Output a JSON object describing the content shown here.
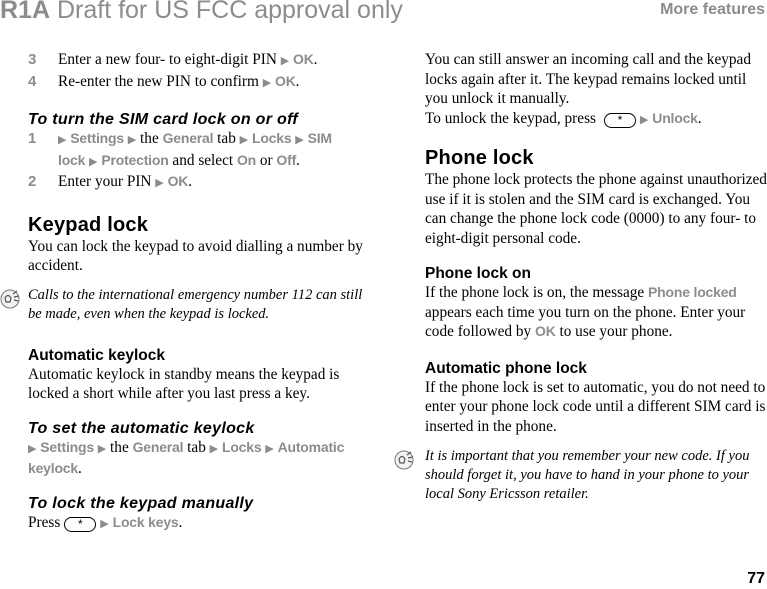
{
  "header": {
    "draft_bold": "R1A",
    "draft_rest": " Draft for US FCC approval only",
    "section_title": "More features"
  },
  "page_number": "77",
  "colors": {
    "ui_gray": "#8c8c8c",
    "text": "#000000"
  },
  "left": {
    "steps_top": [
      {
        "num": "3",
        "text": "Enter a new four- to eight-digit PIN ",
        "ui": "OK"
      },
      {
        "num": "4",
        "text": "Re-enter the new PIN to confirm ",
        "ui": "OK"
      }
    ],
    "sim_heading": "To turn the SIM card lock on or off",
    "sim_step1": {
      "num": "1",
      "settings": "Settings",
      "the": " the ",
      "general": "General",
      "tab": " tab ",
      "locks": "Locks",
      "sim_lock": "SIM lock",
      "protection": "Protection",
      "and_select": " and select ",
      "on": "On",
      "or": " or ",
      "off": "Off"
    },
    "sim_step2": {
      "num": "2",
      "text": "Enter your PIN ",
      "ui": "OK"
    },
    "keypad_heading": "Keypad lock",
    "keypad_body": "You can lock the keypad to avoid dialling a number by accident.",
    "keypad_note": "Calls to the international emergency number 112 can still be made, even when the keypad is locked.",
    "auto_heading": "Automatic keylock",
    "auto_body": "Automatic keylock in standby means the keypad is locked a short while after you last press a key.",
    "set_auto_heading": "To set the automatic keylock",
    "set_auto": {
      "settings": "Settings",
      "the": " the ",
      "general": "General",
      "tab": " tab ",
      "locks": "Locks",
      "automatic": "Automatic keylock"
    },
    "manual_heading": "To lock the keypad manually",
    "manual": {
      "press": "Press",
      "key": "*",
      "action": "Lock keys"
    }
  },
  "right": {
    "intro_body": "You can still answer an incoming call and the keypad locks again after it. The keypad remains locked until you unlock it manually.",
    "unlock": {
      "text": "To unlock the keypad, press",
      "key": "*",
      "action": "Unlock"
    },
    "phone_lock_heading": "Phone lock",
    "phone_lock_body": "The phone lock protects the phone against unauthorized use if it is stolen and the SIM card is exchanged. You can change the phone lock code (0000) to any four- to eight-digit personal code.",
    "phone_lock_on_heading": "Phone lock on",
    "phone_lock_on": {
      "pre": "If the phone lock is on, the message ",
      "ui": "Phone locked",
      "mid": " appears each time you turn on the phone. Enter your code followed by ",
      "ok": "OK",
      "post": " to use your phone."
    },
    "auto_phone_heading": "Automatic phone lock",
    "auto_phone_body": "If the phone lock is set to automatic, you do not need to enter your phone lock code until a different SIM card is inserted in the phone.",
    "note": "It is important that you remember your new code. If you should forget it, you have to hand in your phone to your local Sony Ericsson retailer."
  },
  "icons": {
    "arrow": "▶",
    "tip": "lightbulb-tip-icon"
  }
}
